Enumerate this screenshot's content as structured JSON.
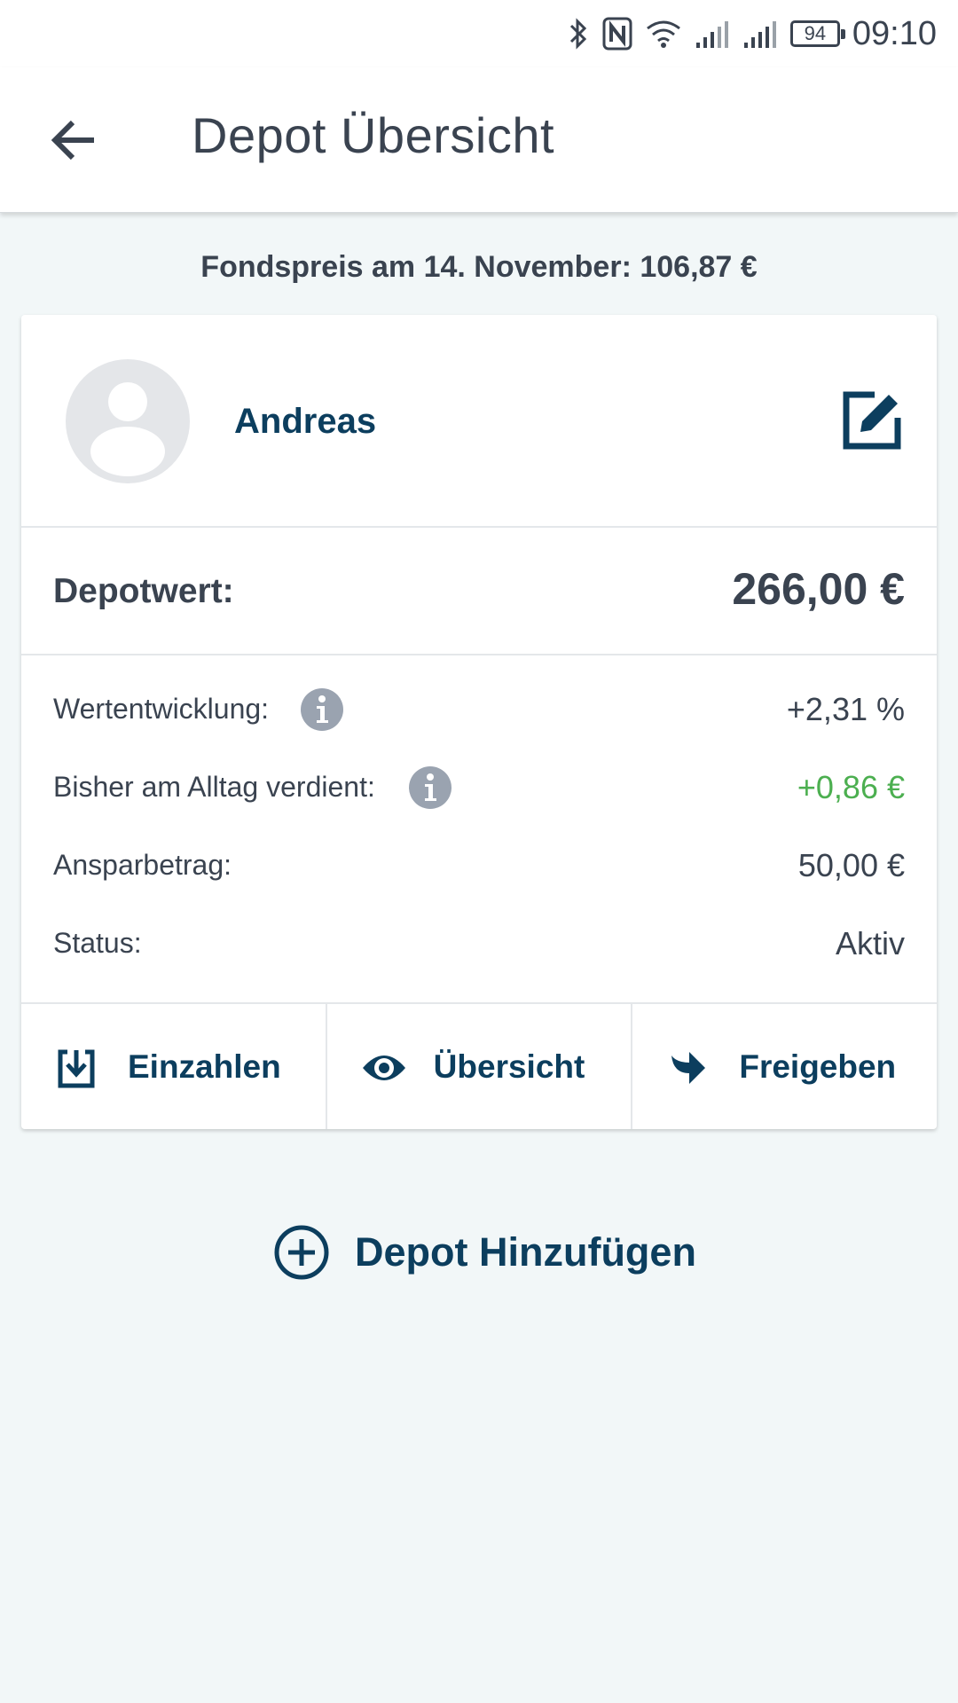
{
  "status_bar": {
    "battery": "94",
    "time": "09:10"
  },
  "app_bar": {
    "title": "Depot Übersicht"
  },
  "fund_price": "Fondspreis am 14. November: 106,87 €",
  "depot": {
    "holder_name": "Andreas",
    "value_label": "Depotwert:",
    "value_amount": "266,00 €",
    "details": [
      {
        "label": "Wertentwicklung:",
        "value": "+2,31 %"
      },
      {
        "label": "Bisher am Alltag verdient:",
        "value": "+0,86 €"
      },
      {
        "label": "Ansparbetrag:",
        "value": "50,00 €"
      },
      {
        "label": "Status:",
        "value": "Aktiv"
      }
    ],
    "actions": [
      {
        "label": "Einzahlen",
        "icon": "deposit-icon"
      },
      {
        "label": "Übersicht",
        "icon": "eye-icon"
      },
      {
        "label": "Freigeben",
        "icon": "share-icon"
      }
    ]
  },
  "add_depot_label": "Depot Hinzufügen",
  "colors": {
    "brand": "#0c3e5e",
    "positive": "#4caf50",
    "background": "#f2f7f8",
    "text": "#3a4350"
  }
}
